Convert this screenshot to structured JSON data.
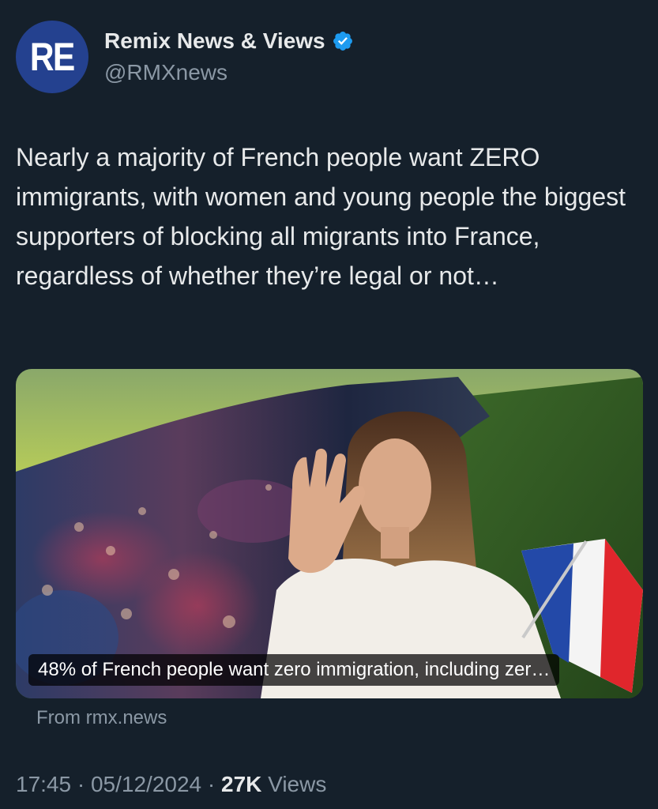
{
  "author": {
    "avatar_text": "RE",
    "display_name": "Remix News & Views",
    "handle": "@RMXnews",
    "verified_icon": "verified-badge-icon"
  },
  "tweet": {
    "text": "Nearly a majority of French people want ZERO immigrants, with women and young people the biggest supporters of blocking all migrants into France, regardless of whether they’re legal or not…"
  },
  "link_card": {
    "caption": "48% of French people want zero immigration, including zer…",
    "source": "From rmx.news"
  },
  "meta": {
    "time": "17:45",
    "separator": "·",
    "date": "05/12/2024",
    "views_count": "27K",
    "views_label": "Views"
  },
  "colors": {
    "background": "#15202b",
    "primary_text": "#e7e9ea",
    "secondary_text": "#8b98a5",
    "verified": "#1d9bf0",
    "avatar": "#24418f"
  }
}
